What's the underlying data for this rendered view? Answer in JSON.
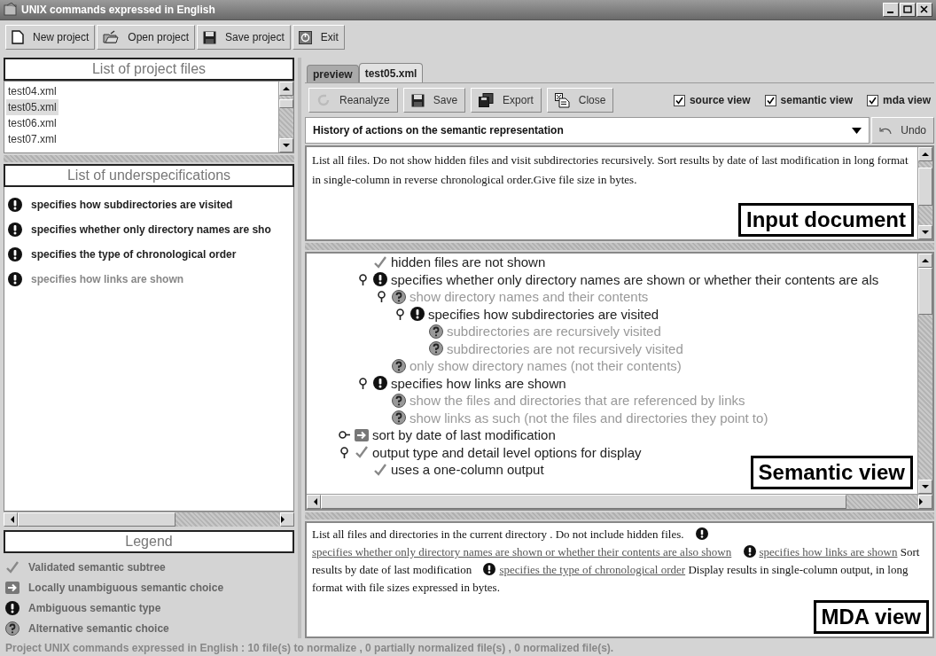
{
  "window": {
    "title": "UNIX commands expressed in English"
  },
  "toolbar": [
    {
      "label": "New project"
    },
    {
      "label": "Open project"
    },
    {
      "label": "Save project"
    },
    {
      "label": "Exit"
    }
  ],
  "project_files": {
    "title": "List of project files",
    "items": [
      {
        "label": "test04.xml",
        "selected": false
      },
      {
        "label": "test05.xml",
        "selected": true
      },
      {
        "label": "test06.xml",
        "selected": false
      },
      {
        "label": "test07.xml",
        "selected": false
      }
    ]
  },
  "underspecifications": {
    "title": "List of underspecifications",
    "items": [
      {
        "label": "specifies how subdirectories are visited",
        "greyed": false
      },
      {
        "label": "specifies whether only directory names are sho",
        "greyed": false
      },
      {
        "label": "specifies the type of chronological order",
        "greyed": false
      },
      {
        "label": "specifies how links are shown",
        "greyed": true
      }
    ]
  },
  "legend": {
    "title": "Legend",
    "items": [
      {
        "kind": "check",
        "label": "Validated semantic subtree"
      },
      {
        "kind": "arrow",
        "label": "Locally unambiguous semantic choice"
      },
      {
        "kind": "ambiguous",
        "label": "Ambiguous semantic type"
      },
      {
        "kind": "alternative",
        "label": "Alternative semantic choice"
      }
    ]
  },
  "tabs": [
    {
      "label": "preview",
      "selected": false
    },
    {
      "label": "test05.xml",
      "selected": true
    }
  ],
  "editor_toolbar": [
    {
      "label": "Reanalyze"
    },
    {
      "label": "Save"
    },
    {
      "label": "Export"
    },
    {
      "label": "Close"
    }
  ],
  "view_options": [
    {
      "label": "source view",
      "checked": true
    },
    {
      "label": "semantic view",
      "checked": true
    },
    {
      "label": "mda view",
      "checked": true
    }
  ],
  "history": {
    "value": "History of actions on the semantic representation",
    "undo": "Undo"
  },
  "input_document": {
    "text": "List all files. Do not show hidden files and visit subdirectories recursively. Sort results by date of last modification in long format in single-column in reverse chronological order.Give file size in bytes.",
    "caption": "Input document"
  },
  "semantic_view": {
    "caption": "Semantic view",
    "nodes": [
      {
        "children": [
          {
            "label": "hidden files are not shown",
            "kind": "check"
          },
          {
            "label": "specifies whether only directory names are shown or whether their contents are als",
            "kind": "ambiguous",
            "expanded": true,
            "children": [
              {
                "label": "show directory names and their contents",
                "kind": "alternative",
                "expanded": true,
                "children": [
                  {
                    "label": "specifies how subdirectories are visited",
                    "kind": "ambiguous",
                    "expanded": true,
                    "children": [
                      {
                        "label": "subdirectories are recursively visited",
                        "kind": "alternative"
                      },
                      {
                        "label": "subdirectories are not recursively visited",
                        "kind": "alternative"
                      }
                    ]
                  }
                ]
              },
              {
                "label": "only show directory names (not their contents)",
                "kind": "alternative"
              }
            ]
          },
          {
            "label": "specifies how links are shown",
            "kind": "ambiguous",
            "expanded": true,
            "children": [
              {
                "label": "show the files and directories that are referenced by links",
                "kind": "alternative"
              },
              {
                "label": "show links as such (not the files and directories they point to)",
                "kind": "alternative"
              }
            ]
          }
        ]
      },
      {
        "label": "sort by date of last modification",
        "kind": "arrow",
        "expanded": false
      },
      {
        "label": "output type and detail level options for display",
        "kind": "check",
        "expanded": true,
        "children": [
          {
            "label": "uses a one-column output",
            "kind": "check"
          }
        ]
      }
    ]
  },
  "mda_view": {
    "caption": "MDA view",
    "segments": [
      {
        "kind": "text",
        "text": "List all files and directories in the current directory . Do not include hidden files."
      },
      {
        "kind": "ambiguous_link",
        "text": "specifies whether only directory names are shown or whether their contents are also shown"
      },
      {
        "kind": "ambiguous_link",
        "text": "specifies how links are shown"
      },
      {
        "kind": "text",
        "text": "Sort results by date of last modification"
      },
      {
        "kind": "ambiguous_link",
        "text": "specifies the type of chronological order"
      },
      {
        "kind": "text",
        "text": "Display results in single-column output, in long format with file sizes expressed in bytes."
      }
    ]
  },
  "status_bar": "Project UNIX commands expressed in English : 10 file(s) to normalize , 0 partially normalized file(s) , 0 normalized file(s)."
}
